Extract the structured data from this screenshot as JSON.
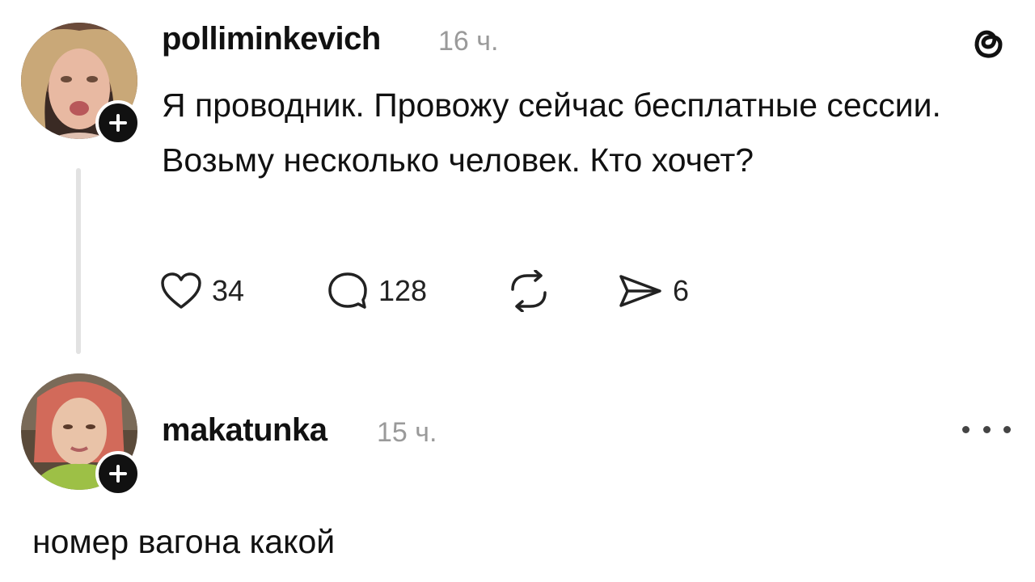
{
  "post": {
    "author": {
      "username": "polliminkevich",
      "time": "16 ч.",
      "avatar_icon": "user-avatar-photo",
      "follow_icon": "plus-icon"
    },
    "text": "Я проводник. Провожу сейчас бесплатные сессии. Возьму несколько человек. Кто хочет?",
    "actions": {
      "like_count": "34",
      "reply_count": "128",
      "repost_icon": "repost-icon",
      "share_count": "6"
    },
    "app_icon": "threads-logo-icon"
  },
  "reply": {
    "author": {
      "username": "makatunka",
      "time": "15 ч.",
      "avatar_icon": "user-avatar-photo",
      "follow_icon": "plus-icon"
    },
    "text": "номер вагона какой",
    "more_icon": "more-horizontal-icon"
  },
  "colors": {
    "background": "#ffffff",
    "text": "#111111",
    "secondary_text": "#9a9a9a",
    "thread_line": "#e2e2e2"
  }
}
